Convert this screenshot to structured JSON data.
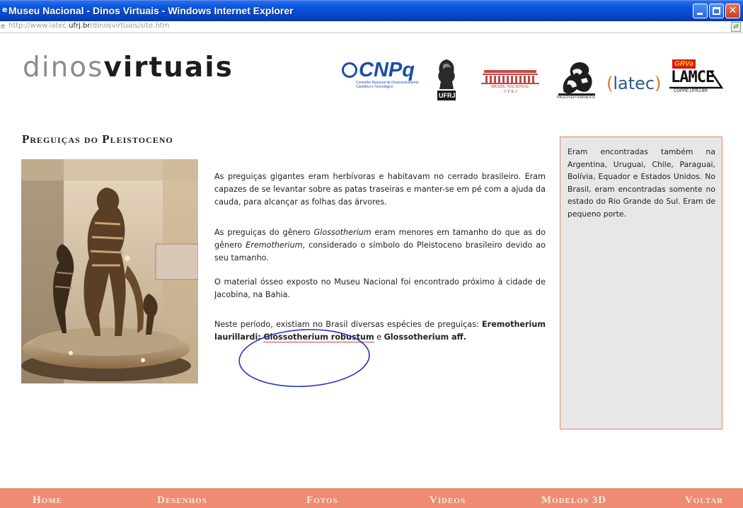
{
  "window": {
    "title": "Museu Nacional - Dinos Virtuais - Windows Internet Explorer",
    "icon": "ie-icon",
    "buttons": [
      "minimize",
      "maximize",
      "close"
    ]
  },
  "address_bar": {
    "url_prefix": "http://www.latec.",
    "url_domain": "ufrj.br",
    "url_path": "/dinosvirtuais/site.htm"
  },
  "header": {
    "logo_part1": "dinos",
    "logo_part2": "virtuais",
    "partners": {
      "cnpq": "CNPq",
      "cnpq_sub": "Conselho Nacional de Desenvolvimento Científico e Tecnológico",
      "ufrj": "UFRJ",
      "museu": "MUSEU NACIONAL",
      "museu_sub": "U F R J",
      "paleo": "PALEOVERTEBRADOS",
      "latec": "latec",
      "lamce_grv": "GRVa",
      "lamce": "LAMCE",
      "lamce_sub": "COPPE.UFRJ.BR"
    }
  },
  "content": {
    "title": "Preguiças do Pleistoceno",
    "p1": "As preguiças gigantes eram herbívoras e habitavam no cerrado brasileiro. Eram capazes de se levantar sobre as patas traseiras e manter-se em pé com a ajuda da cauda, para alcançar as folhas das árvores.",
    "p2_a": "As preguiças do gênero ",
    "p2_genus1": "Glossotherium",
    "p2_b": " eram menores em tamanho do que as do gênero ",
    "p2_genus2": "Eremotherium",
    "p2_c": ", considerado o símbolo do Pleistoceno brasileiro devido ao seu tamanho.",
    "p3": "O material ósseo exposto no Museu Nacional foi encontrado próximo à cidade de Jacobina, na Bahia.",
    "p4_a": "Neste período, existiam no Brasil diversas espécies de preguiças: ",
    "p4_sp1": "Eremotherium laurillardi;",
    "p4_sp2": "Glossotherium robustum",
    "p4_and": " e ",
    "p4_sp3": "Glossotherium aff."
  },
  "sidebar": {
    "text": "Eram encontradas também na Argentina, Uruguai, Chile, Paraguai, Bolívia, Equador e Estados Unidos. No Brasil, eram encontradas somente no estado do Rio Grande do Sul. Eram de pequeno porte."
  },
  "nav": {
    "items": [
      "Home",
      "Desenhos",
      "Fotos",
      "Vídeos",
      "Modelos 3D",
      "Voltar"
    ]
  },
  "colors": {
    "nav_bg": "#ee8b72",
    "sidebar_bg": "#e7e7e7",
    "sidebar_border": "#e6836a",
    "annotation": "#2233cc",
    "underline": "#d04040"
  }
}
